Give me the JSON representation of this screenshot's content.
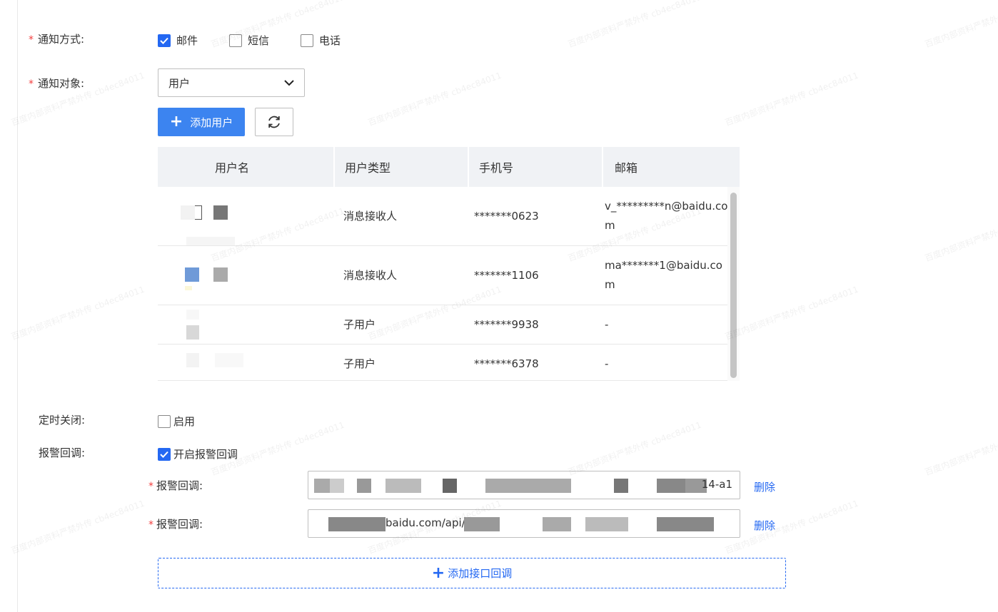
{
  "notify_method": {
    "label": "通知方式:",
    "options": [
      {
        "label": "邮件",
        "checked": true
      },
      {
        "label": "短信",
        "checked": false
      },
      {
        "label": "电话",
        "checked": false
      }
    ]
  },
  "notify_target": {
    "label": "通知对象:",
    "selected": "用户"
  },
  "toolbar": {
    "add_user_label": "添加用户"
  },
  "table": {
    "headers": [
      "用户名",
      "用户类型",
      "手机号",
      "邮箱"
    ],
    "rows": [
      {
        "name": "",
        "type": "消息接收人",
        "phone": "*******0623",
        "email": "v_*********n@baidu.com"
      },
      {
        "name": "",
        "type": "消息接收人",
        "phone": "*******1106",
        "email": "ma*******1@baidu.com"
      },
      {
        "name": "",
        "type": "子用户",
        "phone": "*******9938",
        "email": "-"
      },
      {
        "name": "",
        "type": "子用户",
        "phone": "*******6378",
        "email": "-"
      }
    ]
  },
  "scheduled_close": {
    "label": "定时关闭:",
    "option": "启用",
    "checked": false
  },
  "alarm_callback": {
    "label": "报警回调:",
    "option": "开启报警回调",
    "checked": true,
    "entries": [
      {
        "label": "报警回调:",
        "value_tail": "14-a1",
        "delete_label": "删除"
      },
      {
        "label": "报警回调:",
        "value_tail": "baidu.com/api/",
        "delete_label": "删除"
      }
    ],
    "add_label": "添加接口回调"
  },
  "watermark": "百度内部资料严禁外传 cb4ec84011",
  "colors": {
    "accent": "#2468f2",
    "required": "#f33e3e"
  }
}
